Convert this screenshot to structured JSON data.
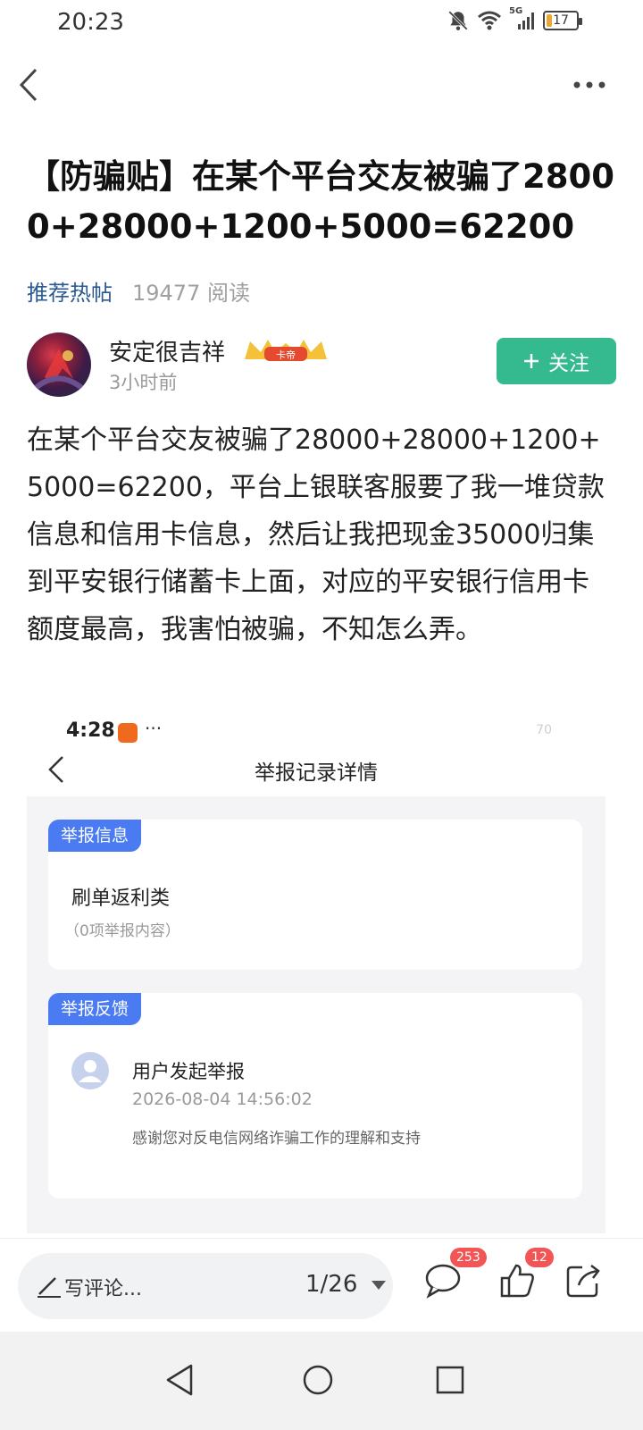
{
  "status_bar": {
    "time": "20:23",
    "network": "5G",
    "battery": "17",
    "battery_level": 0.17,
    "icons": [
      "mute-bell-icon",
      "wifi-icon",
      "signal-icon",
      "battery-icon"
    ]
  },
  "nav": {
    "back_icon": "back-icon",
    "more_icon": "more-icon"
  },
  "post": {
    "title": "【防骗贴】在某个平台交友被骗了28000+28000+1200+5000=62200",
    "topic": "推荐热帖",
    "read_count": "19477 阅读",
    "author": {
      "name": "安定很吉祥",
      "badge_text": "卡帝",
      "time": "3小时前"
    },
    "follow_label": "关注",
    "body": "在某个平台交友被骗了28000+28000+1200+5000=62200，平台上银联客服要了我一堆贷款信息和信用卡信息，然后让我把现金35000归集到平安银行储蓄卡上面，对应的平安银行信用卡额度最高，我害怕被骗，不知怎么弄。"
  },
  "embedded_screenshot": {
    "time": "4:28",
    "dots": "···",
    "corner_num": "70",
    "title": "举报记录详情",
    "report_info": {
      "tag": "举报信息",
      "category": "刷单返利类",
      "count_text": "（0项举报内容）"
    },
    "report_feedback": {
      "tag": "举报反馈",
      "event": "用户发起举报",
      "time": "2026-08-04 14:56:02",
      "note": "感谢您对反电信网络诈骗工作的理解和支持"
    }
  },
  "bottom_bar": {
    "comment_placeholder": "写评论...",
    "page": "1/26",
    "comment_count": "253",
    "like_count": "12",
    "icons": [
      "pen-icon",
      "dropdown-icon",
      "comment-icon",
      "like-icon",
      "share-icon"
    ]
  },
  "colors": {
    "follow_button": "#35b98e",
    "topic_link": "#2a5a90",
    "tag_blue": "#4a7bf2",
    "badge_red": "#f25555"
  }
}
